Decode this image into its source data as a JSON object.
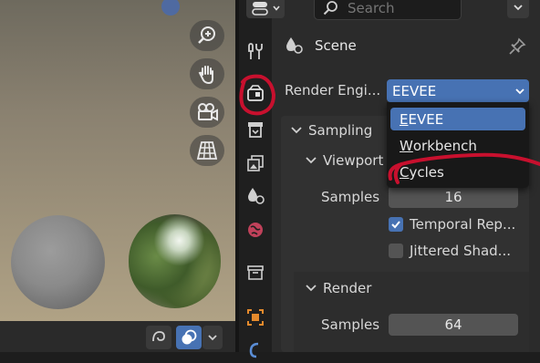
{
  "header": {
    "search_placeholder": "Search"
  },
  "context": {
    "title": "Scene"
  },
  "render_engine": {
    "label": "Render Engi...",
    "value": "EEVEE",
    "options": [
      {
        "first": "E",
        "rest": "EVEE",
        "selected": true
      },
      {
        "first": "W",
        "rest": "orkbench",
        "selected": false
      },
      {
        "first": "C",
        "rest": "ycles",
        "selected": false
      }
    ]
  },
  "sampling": {
    "header": "Sampling",
    "viewport": {
      "header": "Viewport",
      "samples_label": "Samples",
      "samples_value": "16",
      "temporal_label": "Temporal Rep...",
      "temporal_checked": true,
      "jittered_label": "Jittered Shad...",
      "jittered_checked": false
    },
    "render": {
      "header": "Render",
      "samples_label": "Samples",
      "samples_value": "64"
    }
  },
  "colors": {
    "accent": "#4772b3",
    "annotation_red": "#c8102e",
    "panel_bg": "#2b2b2b",
    "tab_bg": "#1f1f1f"
  },
  "icons": {
    "tabs": [
      "tool-icon",
      "render-icon",
      "output-icon",
      "view-layer-icon",
      "scene-icon",
      "world-icon",
      "collection-icon",
      "object-icon",
      "modifier-icon"
    ],
    "viewport_nav": [
      "zoom-icon",
      "hand-pan-icon",
      "camera-icon",
      "grid-perspective-icon"
    ]
  }
}
